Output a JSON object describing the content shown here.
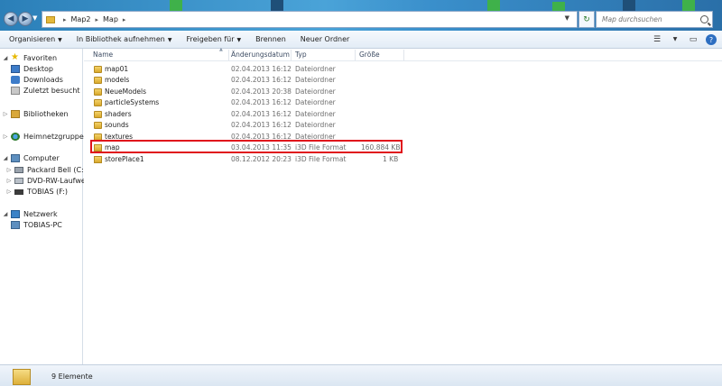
{
  "address": {
    "crumbs": [
      "Map2",
      "Map"
    ],
    "search_placeholder": "Map durchsuchen"
  },
  "toolbar": {
    "organize": "Organisieren",
    "include_library": "In Bibliothek aufnehmen",
    "share": "Freigeben für",
    "burn": "Brennen",
    "new_folder": "Neuer Ordner"
  },
  "nav": {
    "favorites": "Favoriten",
    "desktop": "Desktop",
    "downloads": "Downloads",
    "recent": "Zuletzt besucht",
    "libraries": "Bibliotheken",
    "homegroup": "Heimnetzgruppe",
    "computer": "Computer",
    "drive_c": "Packard Bell (C:)",
    "drive_dvd": "DVD-RW-Laufwerk (",
    "drive_f": "TOBIAS (F:)",
    "network": "Netzwerk",
    "network_pc": "TOBIAS-PC"
  },
  "columns": {
    "name": "Name",
    "date": "Änderungsdatum",
    "type": "Typ",
    "size": "Größe"
  },
  "files": [
    {
      "name": "map01",
      "date": "02.04.2013 16:12",
      "type": "Dateiordner",
      "size": ""
    },
    {
      "name": "models",
      "date": "02.04.2013 16:12",
      "type": "Dateiordner",
      "size": ""
    },
    {
      "name": "NeueModels",
      "date": "02.04.2013 20:38",
      "type": "Dateiordner",
      "size": ""
    },
    {
      "name": "particleSystems",
      "date": "02.04.2013 16:12",
      "type": "Dateiordner",
      "size": ""
    },
    {
      "name": "shaders",
      "date": "02.04.2013 16:12",
      "type": "Dateiordner",
      "size": ""
    },
    {
      "name": "sounds",
      "date": "02.04.2013 16:12",
      "type": "Dateiordner",
      "size": ""
    },
    {
      "name": "textures",
      "date": "02.04.2013 16:12",
      "type": "Dateiordner",
      "size": ""
    },
    {
      "name": "map",
      "date": "03.04.2013 11:35",
      "type": "i3D File Format",
      "size": "160.884 KB"
    },
    {
      "name": "storePlace1",
      "date": "08.12.2012 20:23",
      "type": "i3D File Format",
      "size": "1 KB"
    }
  ],
  "status": {
    "count": "9 Elemente"
  }
}
